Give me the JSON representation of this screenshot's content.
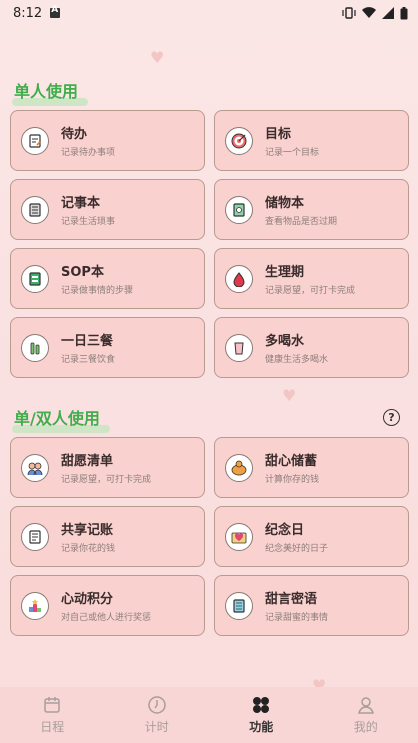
{
  "status": {
    "time": "8:12"
  },
  "section1": {
    "title": "单人使用",
    "items": [
      {
        "title": "待办",
        "desc": "记录待办事项",
        "icon": "todo-icon"
      },
      {
        "title": "目标",
        "desc": "记录一个目标",
        "icon": "target-icon"
      },
      {
        "title": "记事本",
        "desc": "记录生活琐事",
        "icon": "notebook-icon"
      },
      {
        "title": "储物本",
        "desc": "查看物品是否过期",
        "icon": "storage-icon"
      },
      {
        "title": "SOP本",
        "desc": "记录做事情的步骤",
        "icon": "sop-icon"
      },
      {
        "title": "生理期",
        "desc": "记录愿望，可打卡完成",
        "icon": "period-icon"
      },
      {
        "title": "一日三餐",
        "desc": "记录三餐饮食",
        "icon": "meal-icon"
      },
      {
        "title": "多喝水",
        "desc": "健康生活多喝水",
        "icon": "water-icon"
      }
    ]
  },
  "section2": {
    "title": "单/双人使用",
    "items": [
      {
        "title": "甜愿清单",
        "desc": "记录愿望，可打卡完成",
        "icon": "wishlist-icon"
      },
      {
        "title": "甜心储蓄",
        "desc": "计算你存的钱",
        "icon": "savings-icon"
      },
      {
        "title": "共享记账",
        "desc": "记录你花的钱",
        "icon": "accounting-icon"
      },
      {
        "title": "纪念日",
        "desc": "纪念美好的日子",
        "icon": "anniversary-icon"
      },
      {
        "title": "心动积分",
        "desc": "对自己或他人进行奖惩",
        "icon": "points-icon"
      },
      {
        "title": "甜言密语",
        "desc": "记录甜蜜的事情",
        "icon": "sweet-words-icon"
      }
    ]
  },
  "tabs": [
    {
      "label": "日程",
      "icon": "calendar-icon",
      "active": false
    },
    {
      "label": "计时",
      "icon": "clock-icon",
      "active": false
    },
    {
      "label": "功能",
      "icon": "grid-icon",
      "active": true
    },
    {
      "label": "我的",
      "icon": "person-icon",
      "active": false
    }
  ]
}
